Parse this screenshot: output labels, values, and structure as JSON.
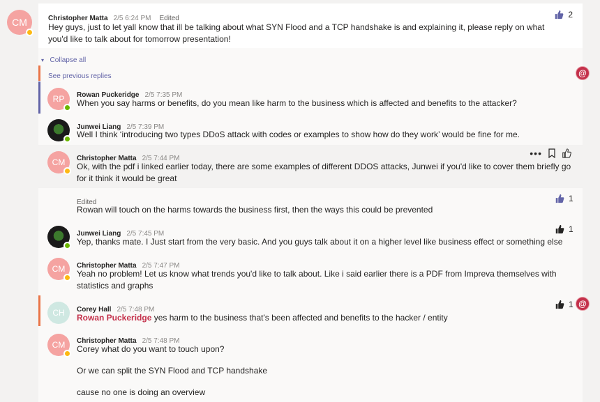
{
  "root": {
    "avatar": "CM",
    "author": "Christopher Matta",
    "time": "2/5 6:24 PM",
    "edited": "Edited",
    "text": "Hey guys, just to let yall know that ill be talking about what  SYN Flood and a TCP handshake is and explaining it, please reply on what you'd like to talk about for tomorrow presentation!",
    "likes": "2"
  },
  "thread": {
    "collapse_label": "Collapse all",
    "see_previous": "See previous replies"
  },
  "replies": [
    {
      "avatar": "RP",
      "author": "Rowan Puckeridge",
      "time": "2/5 7:35 PM",
      "text": "When you say harms or benefits, do you mean like harm to the business which is affected and benefits to the attacker?"
    },
    {
      "author": "Junwei Liang",
      "time": "2/5 7:39 PM",
      "text": "Well I think ‘introducing two types DDoS attack with codes or examples to show how do they work’ would be fine for me."
    },
    {
      "avatar": "CM",
      "author": "Christopher Matta",
      "time": "2/5 7:44 PM",
      "text": "Ok, with the pdf i linked earlier today, there are some examples of different DDOS attacks, Junwei if you'd like to cover them briefly go for it think it would be great"
    },
    {
      "edited": "Edited",
      "text": "Rowan will touch on the harms towards the business first, then the ways this could be prevented",
      "likes": "1"
    },
    {
      "author": "Junwei Liang",
      "time": "2/5 7:45 PM",
      "text": "Yep, thanks mate. I Just start from the very basic. And you guys talk about it on a higher level like business effect or something else",
      "likes": "1"
    },
    {
      "avatar": "CM",
      "author": "Christopher Matta",
      "time": "2/5 7:47 PM",
      "text": "Yeah no problem! Let us know what trends you'd like to talk about. Like i said earlier there is a PDF from Impreva themselves with statistics and graphs"
    },
    {
      "avatar": "CH",
      "author": "Corey Hall",
      "time": "2/5 7:48 PM",
      "mention": "Rowan Puckeridge",
      "text": " yes harm to the business that's been affected and benefits to the hacker / entity",
      "likes": "1"
    },
    {
      "avatar": "CM",
      "author": "Christopher Matta",
      "time": "2/5 7:48 PM",
      "text": "Corey what do you want to touch upon?",
      "text2": "Or we can split the SYN Flood and TCP handshake",
      "text3": "cause no one is doing an overview"
    }
  ],
  "mention_badge": "@",
  "colors": {
    "accent": "#6264a7",
    "mention": "#c4314b",
    "away": "#fdb913",
    "online": "#6bb700"
  }
}
